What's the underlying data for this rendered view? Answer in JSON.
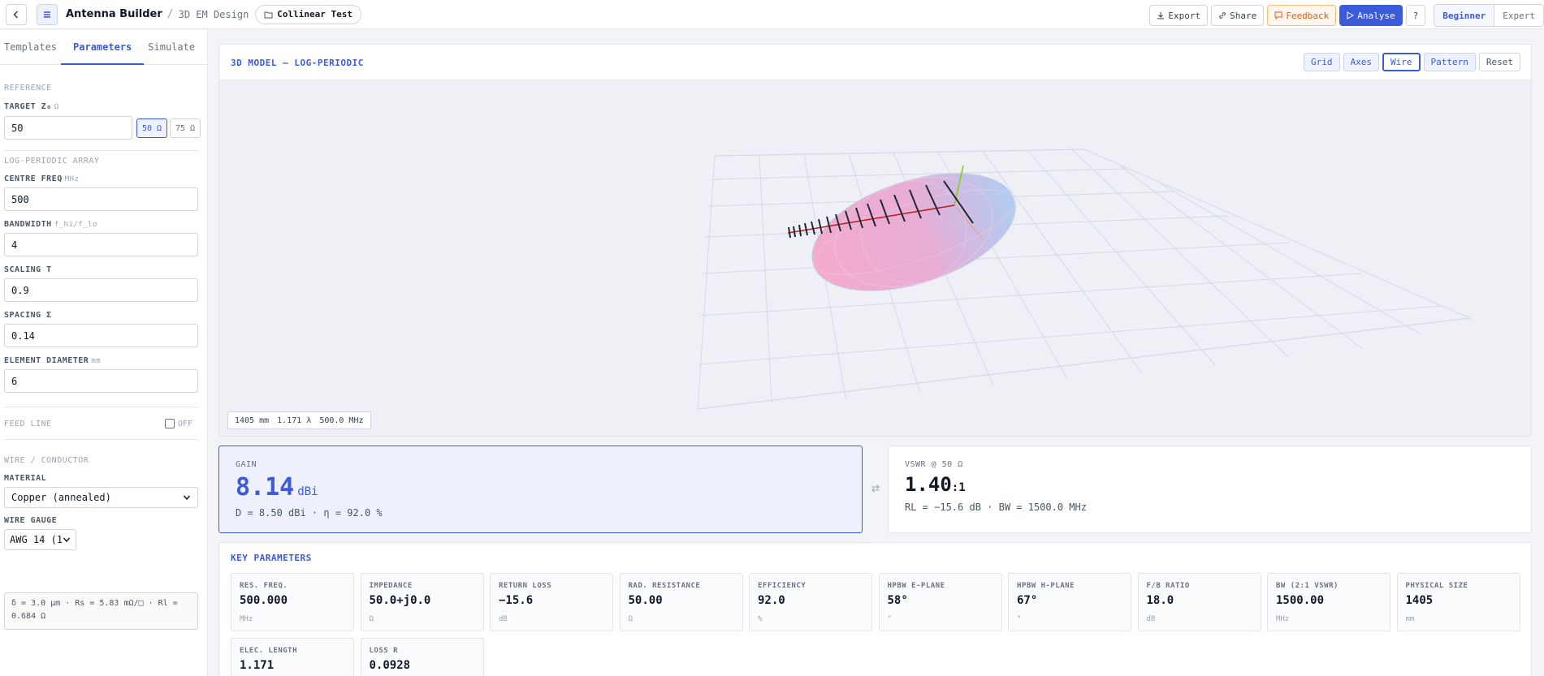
{
  "topbar": {
    "app_title": "Antenna Builder",
    "separator": "/",
    "crumb": "3D EM Design",
    "project": "Collinear Test",
    "buttons": {
      "export": "Export",
      "share": "Share",
      "feedback": "Feedback",
      "analyse": "Analyse",
      "help": "?"
    },
    "modes": [
      "Beginner",
      "Expert"
    ]
  },
  "sidebar": {
    "tabs": [
      "Templates",
      "Parameters",
      "Simulate"
    ],
    "reference": {
      "title": "REFERENCE",
      "target_label": "TARGET Z₀",
      "target_unit": "Ω",
      "target_value": "50",
      "btn_50": "50 Ω",
      "btn_75": "75 Ω"
    },
    "lpda": {
      "title": "LOG-PERIODIC ARRAY",
      "fields": [
        {
          "label": "CENTRE FREQ",
          "unit": "MHz",
          "value": "500"
        },
        {
          "label": "BANDWIDTH",
          "unit": "f_hi/f_lo",
          "value": "4"
        },
        {
          "label": "SCALING T",
          "unit": "",
          "value": "0.9"
        },
        {
          "label": "SPACING Σ",
          "unit": "",
          "value": "0.14"
        },
        {
          "label": "ELEMENT DIAMETER",
          "unit": "mm",
          "value": "6"
        }
      ]
    },
    "feed_line": {
      "title": "FEED LINE",
      "toggle": "OFF"
    },
    "wire": {
      "title": "WIRE / CONDUCTOR",
      "material_label": "MATERIAL",
      "material_value": "Copper (annealed)",
      "gauge_label": "WIRE GAUGE",
      "gauge_value": "AWG 14 (1.",
      "info": "δ = 3.0 µm  ·  Rs = 5.83 mΩ/□  ·  Rl = 0.684 Ω"
    }
  },
  "viewport": {
    "title": "3D MODEL — LOG-PERIODIC",
    "tools": [
      "Grid",
      "Axes",
      "Wire",
      "Pattern",
      "Reset"
    ],
    "status": [
      "1405 mm",
      "1.171 λ",
      "500.0 MHz"
    ]
  },
  "gain": {
    "label": "GAIN",
    "value": "8.14",
    "unit": "dBi",
    "sub": "D = 8.50 dBi · η = 92.0 %"
  },
  "vswr": {
    "label": "VSWR @ 50 Ω",
    "value": "1.40",
    "unit": ":1",
    "sub": "RL = −15.6 dB · BW = 1500.0 MHz"
  },
  "key_params": {
    "title": "KEY PARAMETERS",
    "items": [
      {
        "label": "RES. FREQ.",
        "value": "500.000",
        "unit": "MHz"
      },
      {
        "label": "IMPEDANCE",
        "value": "50.0+j0.0",
        "unit": "Ω"
      },
      {
        "label": "RETURN LOSS",
        "value": "−15.6",
        "unit": "dB"
      },
      {
        "label": "RAD. RESISTANCE",
        "value": "50.00",
        "unit": "Ω"
      },
      {
        "label": "EFFICIENCY",
        "value": "92.0",
        "unit": "%"
      },
      {
        "label": "HPBW E-PLANE",
        "value": "58°",
        "unit": "°"
      },
      {
        "label": "HPBW H-PLANE",
        "value": "67°",
        "unit": "°"
      },
      {
        "label": "F/B RATIO",
        "value": "18.0",
        "unit": "dB"
      },
      {
        "label": "BW (2:1 VSWR)",
        "value": "1500.00",
        "unit": "MHz"
      },
      {
        "label": "PHYSICAL SIZE",
        "value": "1405",
        "unit": "mm"
      },
      {
        "label": "ELEC. LENGTH",
        "value": "1.171",
        "unit": ""
      },
      {
        "label": "LOSS R",
        "value": "0.0928",
        "unit": ""
      }
    ]
  },
  "colors": {
    "accent": "#3b5bdb",
    "feedback": "#ea580c"
  }
}
